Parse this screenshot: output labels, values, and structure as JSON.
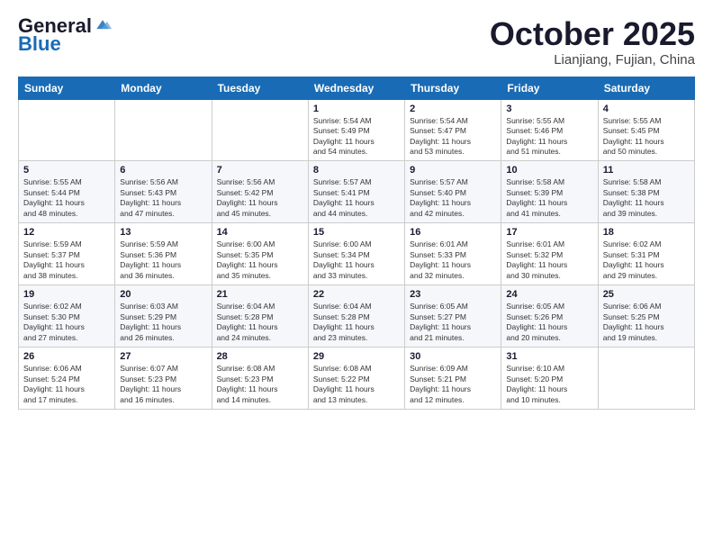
{
  "logo": {
    "general": "General",
    "blue": "Blue"
  },
  "header": {
    "month": "October 2025",
    "location": "Lianjiang, Fujian, China"
  },
  "weekdays": [
    "Sunday",
    "Monday",
    "Tuesday",
    "Wednesday",
    "Thursday",
    "Friday",
    "Saturday"
  ],
  "weeks": [
    [
      {
        "day": "",
        "info": ""
      },
      {
        "day": "",
        "info": ""
      },
      {
        "day": "",
        "info": ""
      },
      {
        "day": "1",
        "info": "Sunrise: 5:54 AM\nSunset: 5:49 PM\nDaylight: 11 hours\nand 54 minutes."
      },
      {
        "day": "2",
        "info": "Sunrise: 5:54 AM\nSunset: 5:47 PM\nDaylight: 11 hours\nand 53 minutes."
      },
      {
        "day": "3",
        "info": "Sunrise: 5:55 AM\nSunset: 5:46 PM\nDaylight: 11 hours\nand 51 minutes."
      },
      {
        "day": "4",
        "info": "Sunrise: 5:55 AM\nSunset: 5:45 PM\nDaylight: 11 hours\nand 50 minutes."
      }
    ],
    [
      {
        "day": "5",
        "info": "Sunrise: 5:55 AM\nSunset: 5:44 PM\nDaylight: 11 hours\nand 48 minutes."
      },
      {
        "day": "6",
        "info": "Sunrise: 5:56 AM\nSunset: 5:43 PM\nDaylight: 11 hours\nand 47 minutes."
      },
      {
        "day": "7",
        "info": "Sunrise: 5:56 AM\nSunset: 5:42 PM\nDaylight: 11 hours\nand 45 minutes."
      },
      {
        "day": "8",
        "info": "Sunrise: 5:57 AM\nSunset: 5:41 PM\nDaylight: 11 hours\nand 44 minutes."
      },
      {
        "day": "9",
        "info": "Sunrise: 5:57 AM\nSunset: 5:40 PM\nDaylight: 11 hours\nand 42 minutes."
      },
      {
        "day": "10",
        "info": "Sunrise: 5:58 AM\nSunset: 5:39 PM\nDaylight: 11 hours\nand 41 minutes."
      },
      {
        "day": "11",
        "info": "Sunrise: 5:58 AM\nSunset: 5:38 PM\nDaylight: 11 hours\nand 39 minutes."
      }
    ],
    [
      {
        "day": "12",
        "info": "Sunrise: 5:59 AM\nSunset: 5:37 PM\nDaylight: 11 hours\nand 38 minutes."
      },
      {
        "day": "13",
        "info": "Sunrise: 5:59 AM\nSunset: 5:36 PM\nDaylight: 11 hours\nand 36 minutes."
      },
      {
        "day": "14",
        "info": "Sunrise: 6:00 AM\nSunset: 5:35 PM\nDaylight: 11 hours\nand 35 minutes."
      },
      {
        "day": "15",
        "info": "Sunrise: 6:00 AM\nSunset: 5:34 PM\nDaylight: 11 hours\nand 33 minutes."
      },
      {
        "day": "16",
        "info": "Sunrise: 6:01 AM\nSunset: 5:33 PM\nDaylight: 11 hours\nand 32 minutes."
      },
      {
        "day": "17",
        "info": "Sunrise: 6:01 AM\nSunset: 5:32 PM\nDaylight: 11 hours\nand 30 minutes."
      },
      {
        "day": "18",
        "info": "Sunrise: 6:02 AM\nSunset: 5:31 PM\nDaylight: 11 hours\nand 29 minutes."
      }
    ],
    [
      {
        "day": "19",
        "info": "Sunrise: 6:02 AM\nSunset: 5:30 PM\nDaylight: 11 hours\nand 27 minutes."
      },
      {
        "day": "20",
        "info": "Sunrise: 6:03 AM\nSunset: 5:29 PM\nDaylight: 11 hours\nand 26 minutes."
      },
      {
        "day": "21",
        "info": "Sunrise: 6:04 AM\nSunset: 5:28 PM\nDaylight: 11 hours\nand 24 minutes."
      },
      {
        "day": "22",
        "info": "Sunrise: 6:04 AM\nSunset: 5:28 PM\nDaylight: 11 hours\nand 23 minutes."
      },
      {
        "day": "23",
        "info": "Sunrise: 6:05 AM\nSunset: 5:27 PM\nDaylight: 11 hours\nand 21 minutes."
      },
      {
        "day": "24",
        "info": "Sunrise: 6:05 AM\nSunset: 5:26 PM\nDaylight: 11 hours\nand 20 minutes."
      },
      {
        "day": "25",
        "info": "Sunrise: 6:06 AM\nSunset: 5:25 PM\nDaylight: 11 hours\nand 19 minutes."
      }
    ],
    [
      {
        "day": "26",
        "info": "Sunrise: 6:06 AM\nSunset: 5:24 PM\nDaylight: 11 hours\nand 17 minutes."
      },
      {
        "day": "27",
        "info": "Sunrise: 6:07 AM\nSunset: 5:23 PM\nDaylight: 11 hours\nand 16 minutes."
      },
      {
        "day": "28",
        "info": "Sunrise: 6:08 AM\nSunset: 5:23 PM\nDaylight: 11 hours\nand 14 minutes."
      },
      {
        "day": "29",
        "info": "Sunrise: 6:08 AM\nSunset: 5:22 PM\nDaylight: 11 hours\nand 13 minutes."
      },
      {
        "day": "30",
        "info": "Sunrise: 6:09 AM\nSunset: 5:21 PM\nDaylight: 11 hours\nand 12 minutes."
      },
      {
        "day": "31",
        "info": "Sunrise: 6:10 AM\nSunset: 5:20 PM\nDaylight: 11 hours\nand 10 minutes."
      },
      {
        "day": "",
        "info": ""
      }
    ]
  ]
}
